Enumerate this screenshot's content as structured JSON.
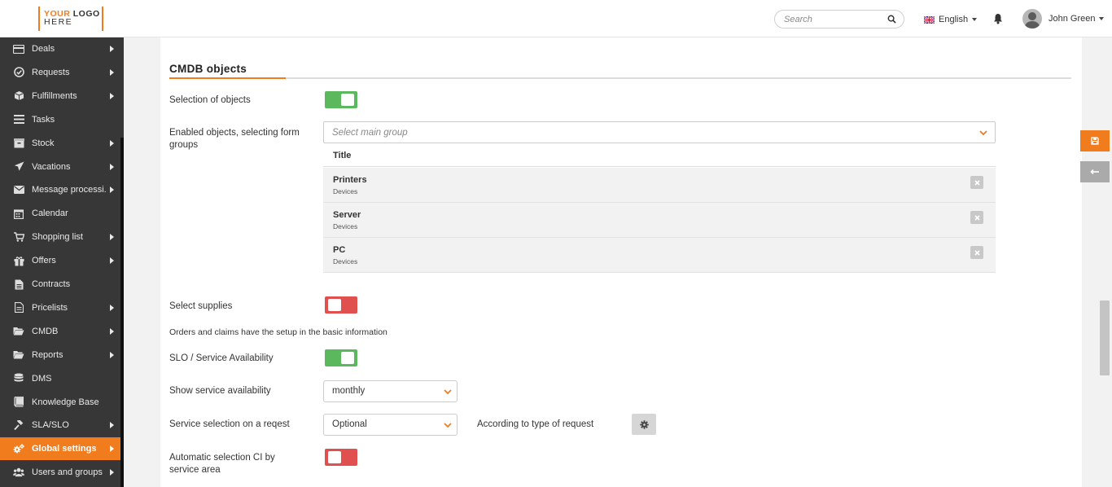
{
  "header": {
    "logo": {
      "line1a": "YOUR",
      "line1b": "LOGO",
      "line2": "HERE"
    },
    "search_placeholder": "Search",
    "language": "English",
    "user_name": "John Green"
  },
  "sidebar": {
    "items": [
      {
        "label": "Deals",
        "icon": "card-icon",
        "arrow": true
      },
      {
        "label": "Requests",
        "icon": "check-circle-icon",
        "arrow": true
      },
      {
        "label": "Fulfillments",
        "icon": "box-icon",
        "arrow": true
      },
      {
        "label": "Tasks",
        "icon": "list-icon",
        "arrow": false
      },
      {
        "label": "Stock",
        "icon": "stock-icon",
        "arrow": true
      },
      {
        "label": "Vacations",
        "icon": "plane-icon",
        "arrow": true
      },
      {
        "label": "Message processi...",
        "icon": "envelope-icon",
        "arrow": true
      },
      {
        "label": "Calendar",
        "icon": "calendar-icon",
        "arrow": false
      },
      {
        "label": "Shopping list",
        "icon": "cart-icon",
        "arrow": true
      },
      {
        "label": "Offers",
        "icon": "gift-icon",
        "arrow": true
      },
      {
        "label": "Contracts",
        "icon": "document-icon",
        "arrow": false
      },
      {
        "label": "Pricelists",
        "icon": "pricelist-icon",
        "arrow": true
      },
      {
        "label": "CMDB",
        "icon": "folder-open-icon",
        "arrow": true
      },
      {
        "label": "Reports",
        "icon": "folder-open-icon",
        "arrow": true
      },
      {
        "label": "DMS",
        "icon": "database-icon",
        "arrow": false
      },
      {
        "label": "Knowledge Base",
        "icon": "book-icon",
        "arrow": false
      },
      {
        "label": "SLA/SLO",
        "icon": "gavel-icon",
        "arrow": true
      },
      {
        "label": "Global settings",
        "icon": "cogs-icon",
        "arrow": true,
        "active": true
      },
      {
        "label": "Users and groups",
        "icon": "users-icon",
        "arrow": true
      }
    ]
  },
  "main": {
    "section_title": "CMDB objects",
    "selection_of_objects": {
      "label": "Selection of objects",
      "state": "on"
    },
    "enabled_objects": {
      "label": "Enabled objects, selecting form groups",
      "select_placeholder": "Select main group",
      "table_header": "Title",
      "rows": [
        {
          "title": "Printers",
          "sub": "Devices"
        },
        {
          "title": "Server",
          "sub": "Devices"
        },
        {
          "title": "PC",
          "sub": "Devices"
        }
      ]
    },
    "select_supplies": {
      "label": "Select supplies",
      "state": "off"
    },
    "orders_note": "Orders and claims have the setup in the basic information",
    "slo_availability": {
      "label": "SLO / Service Availability",
      "state": "on"
    },
    "show_availability": {
      "label": "Show service availability",
      "value": "monthly"
    },
    "service_selection": {
      "label": "Service selection on a reqest",
      "value": "Optional",
      "side_label": "According to type of request"
    },
    "auto_selection": {
      "label": "Automatic selection CI by service area",
      "state": "off"
    }
  },
  "colors": {
    "accent": "#f07c1e",
    "toggle_on": "#5cb85c",
    "toggle_off": "#e0504f",
    "sidebar_bg": "#373737"
  }
}
